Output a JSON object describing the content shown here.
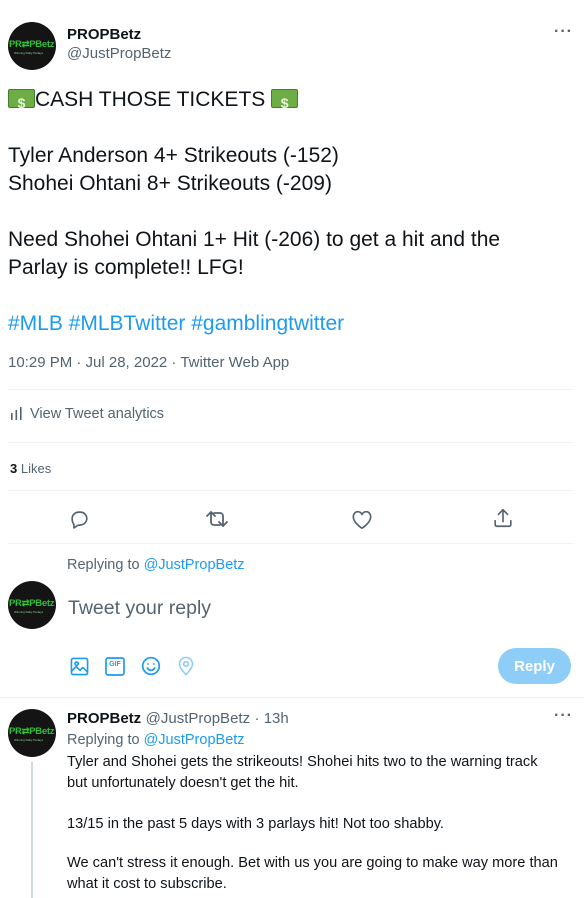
{
  "tweet": {
    "author_name": "PROPBetz",
    "author_handle": "@JustPropBetz",
    "avatar_logo": "PR⇄PBetz",
    "avatar_sub": "Winning Daily Parlays",
    "more_icon": "more-icon",
    "headline": "CASH THOSE TICKETS",
    "line1": "Tyler Anderson 4+ Strikeouts (-152)",
    "line2": "Shohei Ohtani 8+ Strikeouts (-209)",
    "para2_line1": "Need Shohei Ohtani 1+ Hit (-206) to get a hit and the",
    "para2_line2": "Parlay is complete!! LFG!",
    "hashtags": "#MLB #MLBTwitter #gamblingtwitter",
    "timestamp": "10:29 PM · Jul 28, 2022 · Twitter Web App",
    "analytics_label": "View Tweet analytics",
    "likes_count": "3",
    "likes_label": "Likes"
  },
  "actions": {
    "icons": [
      "reply-icon",
      "retweet-icon",
      "like-icon",
      "share-icon"
    ]
  },
  "composer": {
    "replying_prefix": "Replying to",
    "replying_handle": "@JustPropBetz",
    "placeholder": "Tweet your reply",
    "reply_button": "Reply",
    "tool_icons": [
      "image-icon",
      "gif-icon",
      "emoji-icon",
      "location-icon"
    ],
    "gif_label": "GIF"
  },
  "reply": {
    "author_name": "PROPBetz",
    "author_handle": "@JustPropBetz",
    "time": "· 13h",
    "replying_prefix": "Replying to",
    "replying_handle": "@JustPropBetz",
    "p1_line1": "Tyler and Shohei gets the strikeouts! Shohei hits two to the warning track",
    "p1_line2": "but unfortunately doesn't get the hit.",
    "p2": "13/15 in the past 5 days with 3 parlays hit! Not too shabby.",
    "p3_line1": "We can't stress it enough. Bet with us you are going to make way more than",
    "p3_line2": "what it cost to subscribe."
  },
  "colors": {
    "accent": "#1d9bf0",
    "reply_button": "#8ecdf7",
    "text": "#0f1419",
    "muted": "#536471"
  }
}
